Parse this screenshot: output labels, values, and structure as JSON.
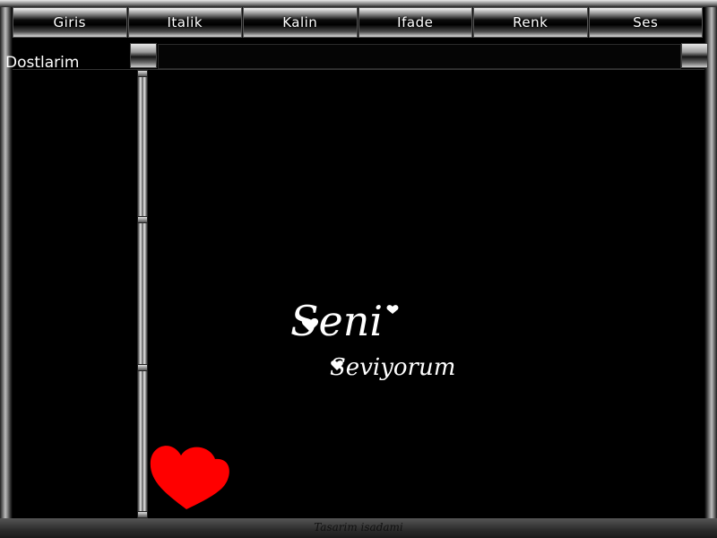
{
  "menu": {
    "items": [
      {
        "label": "Giris"
      },
      {
        "label": "Italik"
      },
      {
        "label": "Kalin"
      },
      {
        "label": "Ifade"
      },
      {
        "label": "Renk"
      },
      {
        "label": "Ses"
      }
    ]
  },
  "sidebar": {
    "title": "Dostlarim"
  },
  "input": {
    "value": ""
  },
  "logo": {
    "line1": "Seni",
    "line2": "Seviyorum"
  },
  "footer": {
    "text": "Tasarim isadami"
  },
  "colors": {
    "heart": "#ff0000",
    "background": "#000000",
    "text": "#ffffff"
  },
  "icons": {
    "decor_heart": "heart-icon"
  }
}
